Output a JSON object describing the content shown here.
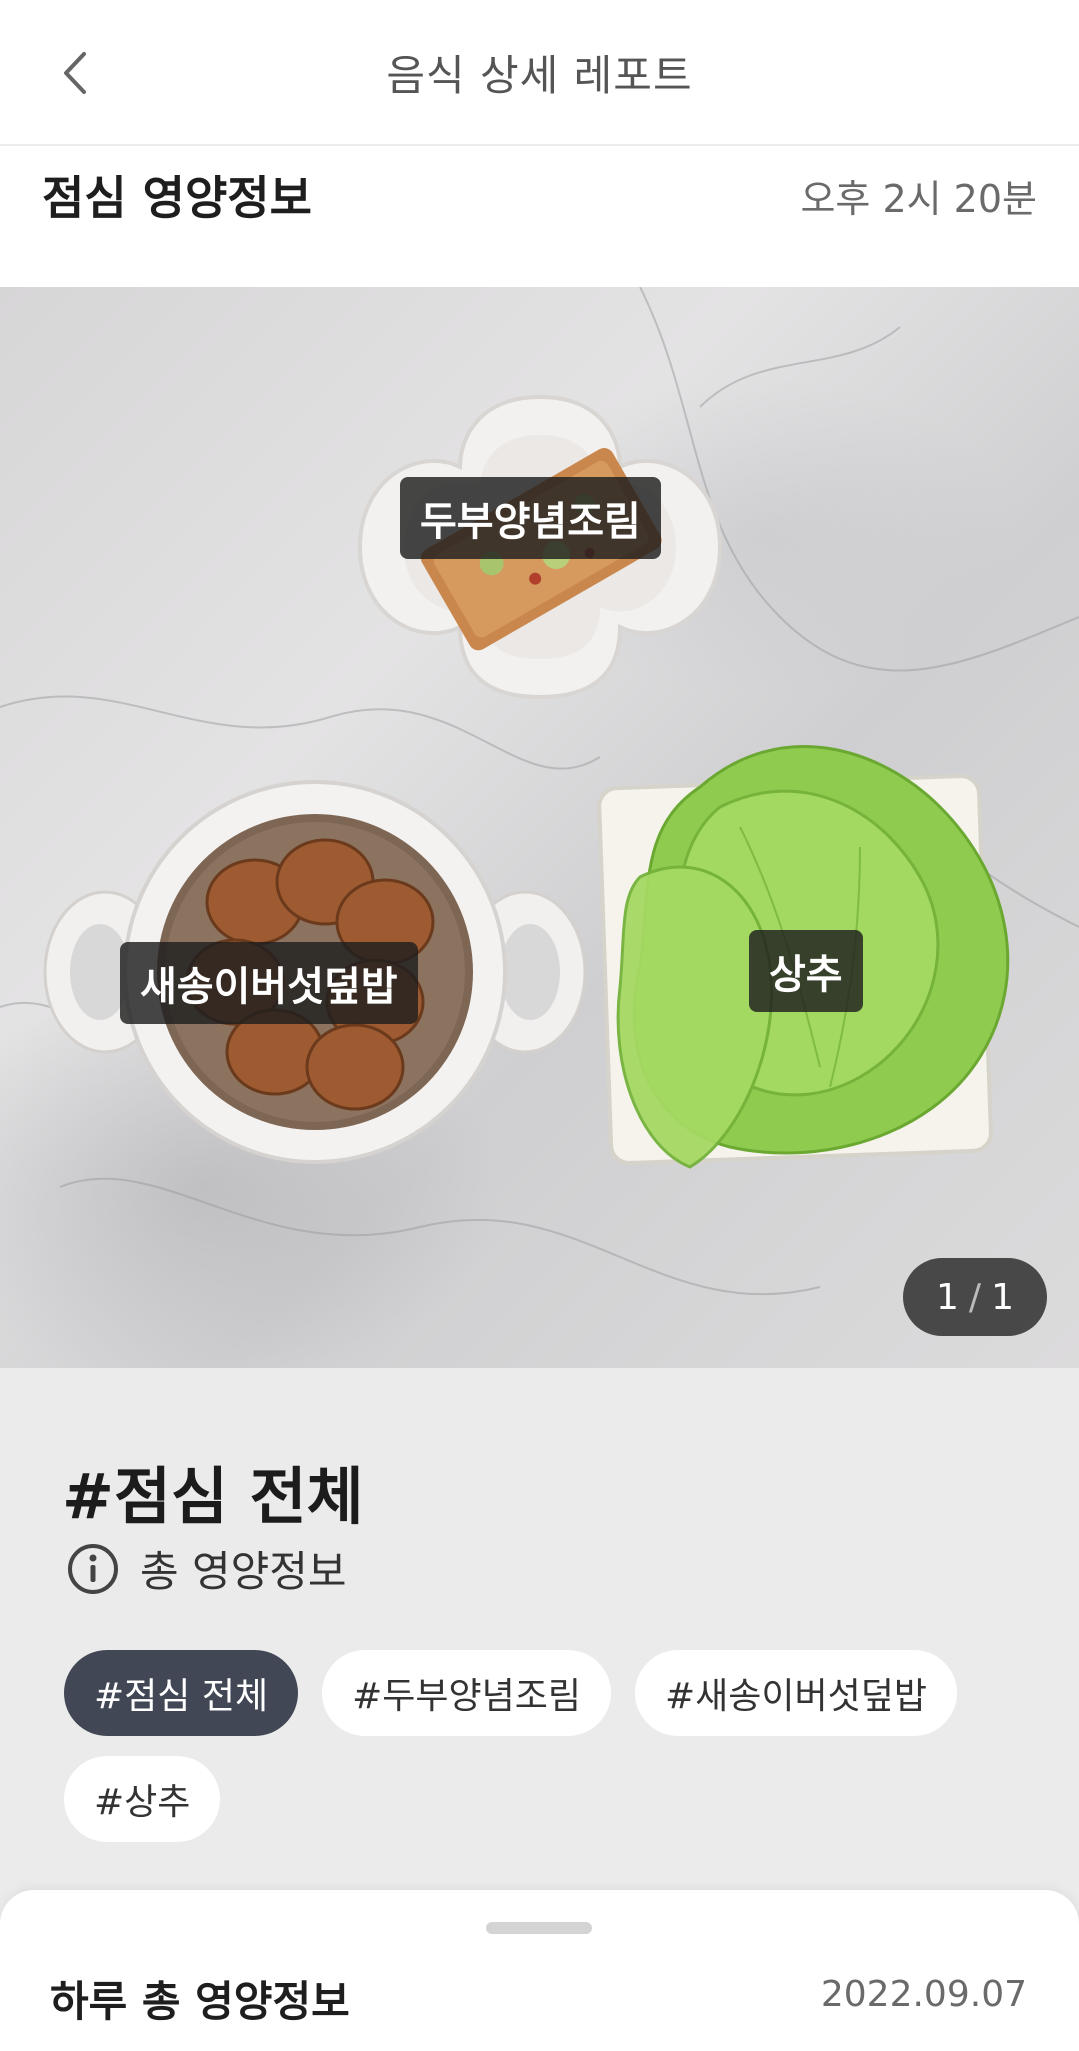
{
  "header": {
    "title": "음식 상세 레포트",
    "back_icon": "chevron-left-icon"
  },
  "meal": {
    "title": "점심 영양정보",
    "time": "오후 2시 20분"
  },
  "photo": {
    "labels": [
      "두부양념조림",
      "새송이버섯덮밥",
      "상추"
    ],
    "pager": {
      "current": "1",
      "separator": "/",
      "total": "1"
    }
  },
  "info": {
    "title": "#점심 전체",
    "total_label": "총 영양정보",
    "info_icon": "info-circle-icon",
    "chips": [
      "#점심 전체",
      "#두부양념조림",
      "#새송이버섯덮밥",
      "#상추"
    ],
    "active_chip": 0
  },
  "sheet": {
    "title": "하루 총 영양정보",
    "date": "2022.09.07"
  },
  "colors": {
    "chip_active": "#424756",
    "section_bg": "#ebebeb",
    "label_bg": "#1e1e1e"
  }
}
